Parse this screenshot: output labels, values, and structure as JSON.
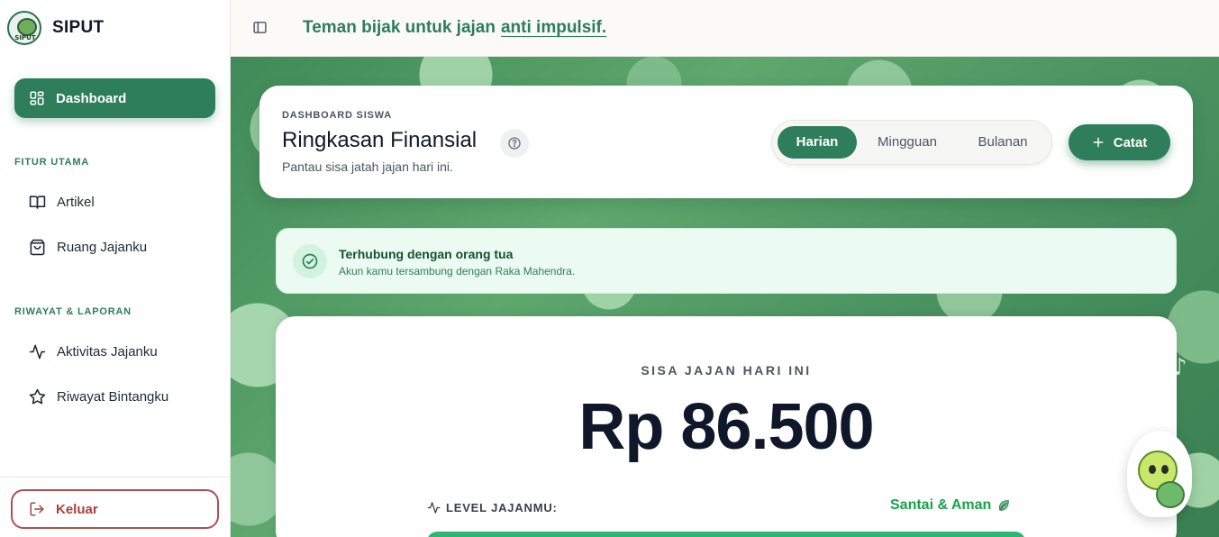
{
  "brand": {
    "name": "SIPUT",
    "logo_text": "SIPUT"
  },
  "sidebar": {
    "active_item": {
      "label": "Dashboard",
      "icon": "grid-icon"
    },
    "sections": [
      {
        "label": "FITUR UTAMA",
        "items": [
          {
            "label": "Artikel",
            "icon": "book-icon"
          },
          {
            "label": "Ruang Jajanku",
            "icon": "shopping-bag-icon"
          }
        ]
      },
      {
        "label": "RIWAYAT & LAPORAN",
        "items": [
          {
            "label": "Aktivitas Jajanku",
            "icon": "activity-icon"
          },
          {
            "label": "Riwayat Bintangku",
            "icon": "star-icon"
          }
        ]
      }
    ],
    "logout_label": "Keluar"
  },
  "topbar": {
    "tagline": "Teman bijak untuk jajan",
    "tagline_highlight": "anti impulsif."
  },
  "header": {
    "eyebrow": "DASHBOARD SISWA",
    "title": "Ringkasan Finansial",
    "subtitle": "Pantau sisa jatah jajan hari ini.",
    "periods": [
      "Harian",
      "Mingguan",
      "Bulanan"
    ],
    "active_period": "Harian",
    "add_label": "Catat"
  },
  "alert": {
    "title": "Terhubung dengan orang tua",
    "message": "Akun kamu tersambung dengan Raka Mahendra."
  },
  "balance": {
    "label": "SISA JAJAN HARI INI",
    "amount": "Rp 86.500",
    "level_label": "LEVEL JAJANMU:",
    "level_status": "Santai & Aman",
    "level_fraction": 1.0
  },
  "colors": {
    "primary": "#2e7d5b",
    "danger": "#a8413f",
    "success": "#16a34a"
  }
}
